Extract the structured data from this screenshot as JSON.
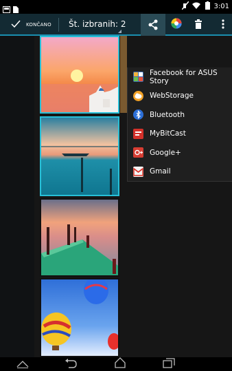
{
  "status_bar": {
    "time": "3:01",
    "icons": [
      "image-icon",
      "document-icon",
      "mute-icon",
      "wifi-icon",
      "battery-icon"
    ]
  },
  "action_bar": {
    "done_label": "KONČANO",
    "selected_count": "Št. izbranih: 2",
    "icons": [
      "checkmark-icon",
      "share-icon",
      "picasa-icon",
      "delete-icon",
      "overflow-menu-icon"
    ]
  },
  "share_menu": {
    "items": [
      {
        "label": "Facebook for ASUS Story",
        "icon": "asus-story-icon"
      },
      {
        "label": "WebStorage",
        "icon": "webstorage-icon"
      },
      {
        "label": "Bluetooth",
        "icon": "bluetooth-icon"
      },
      {
        "label": "MyBitCast",
        "icon": "mybitcast-icon"
      },
      {
        "label": "Google+",
        "icon": "google-plus-icon"
      },
      {
        "label": "Gmail",
        "icon": "gmail-icon"
      }
    ]
  },
  "gallery": {
    "thumbnails": [
      {
        "subject": "sunset-village-photo",
        "selected": true
      },
      {
        "subject": "lake-pier-photo",
        "selected": true
      },
      {
        "subject": "wooden-dock-photo",
        "selected": false
      },
      {
        "subject": "hot-air-balloons-photo",
        "selected": false
      }
    ]
  },
  "nav_bar": {
    "icons": [
      "collapse-icon",
      "back-icon",
      "home-icon",
      "recent-apps-icon"
    ]
  },
  "colors": {
    "accent": "#27c0d8",
    "action_bar": "#132a33",
    "menu_bg": "#1f1f1f"
  }
}
